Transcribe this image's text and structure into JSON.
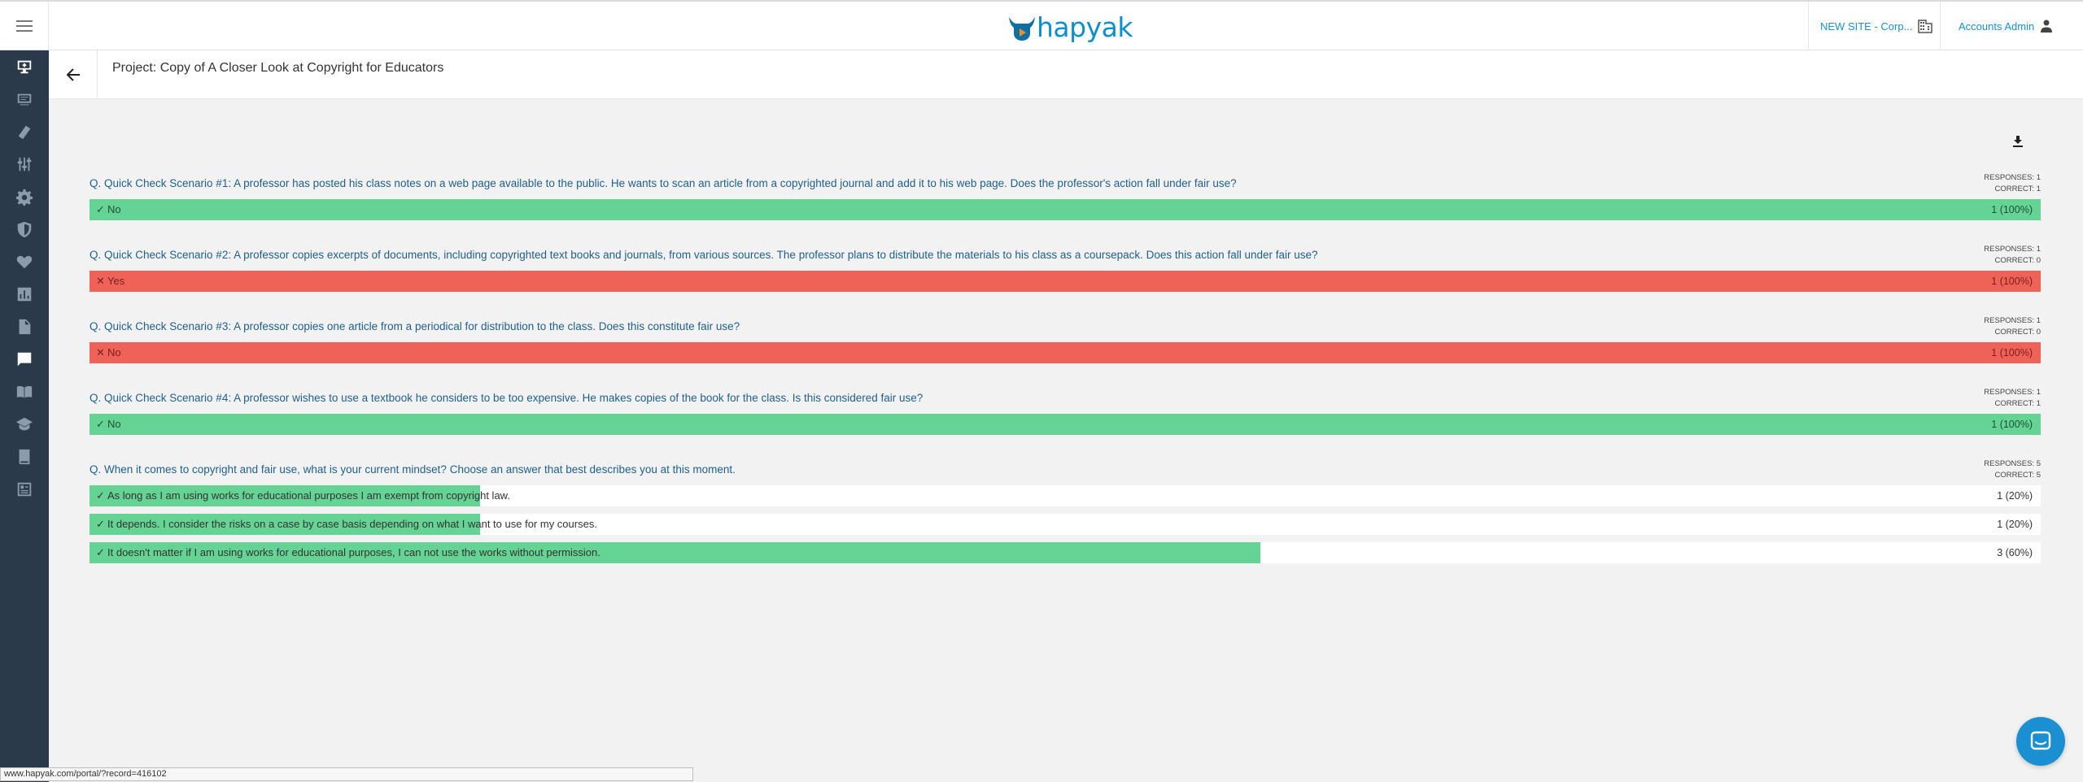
{
  "header": {
    "logo_text": "hapyak",
    "site_selector": "NEW SITE - Corp...",
    "account": "Accounts Admin"
  },
  "sidebar": {
    "items": [
      {
        "icon": "video-add-icon",
        "active": false
      },
      {
        "icon": "playlist-icon",
        "active": false
      },
      {
        "icon": "layers-icon",
        "active": false
      },
      {
        "icon": "sliders-icon",
        "active": false
      },
      {
        "icon": "gear-icon",
        "active": false
      },
      {
        "icon": "shield-icon",
        "active": false
      },
      {
        "icon": "heart-icon",
        "active": false
      },
      {
        "icon": "bar-chart-icon",
        "active": false
      },
      {
        "icon": "document-icon",
        "active": false
      },
      {
        "icon": "chat-bubble-icon",
        "active": true
      },
      {
        "icon": "book-open-icon",
        "active": false
      },
      {
        "icon": "graduation-cap-icon",
        "active": false
      },
      {
        "icon": "book-icon",
        "active": false
      },
      {
        "icon": "report-icon",
        "active": false
      }
    ]
  },
  "project": {
    "title": "Project: Copy of A Closer Look at Copyright for Educators"
  },
  "questions": [
    {
      "title": "Q. Quick Check Scenario #1: A professor has posted his class notes on a web page available to the public. He wants to scan an article from a copyrighted journal and add it to his web page. Does the professor's action fall under fair use?",
      "responses": "RESPONSES: 1",
      "correct": "CORRECT: 1",
      "answers": [
        {
          "mark": "✓",
          "text": "No",
          "count": "1 (100%)",
          "status": "correct",
          "share": 1.0
        }
      ]
    },
    {
      "title": "Q. Quick Check Scenario #2: A professor copies excerpts of documents, including copyrighted text books and journals, from various sources. The professor plans to distribute the materials to his class as a coursepack. Does this action fall under fair use?",
      "responses": "RESPONSES: 1",
      "correct": "CORRECT: 0",
      "answers": [
        {
          "mark": "✕",
          "text": "Yes",
          "count": "1 (100%)",
          "status": "incorrect",
          "share": 1.0
        }
      ]
    },
    {
      "title": "Q. Quick Check Scenario #3: A professor copies one article from a periodical for distribution to the class. Does this constitute fair use?",
      "responses": "RESPONSES: 1",
      "correct": "CORRECT: 0",
      "answers": [
        {
          "mark": "✕",
          "text": "No",
          "count": "1 (100%)",
          "status": "incorrect",
          "share": 1.0
        }
      ]
    },
    {
      "title": "Q. Quick Check Scenario #4: A professor wishes to use a textbook he considers to be too expensive. He makes copies of the book for the class. Is this considered fair use?",
      "responses": "RESPONSES: 1",
      "correct": "CORRECT: 1",
      "answers": [
        {
          "mark": "✓",
          "text": "No",
          "count": "1 (100%)",
          "status": "correct",
          "share": 1.0
        }
      ]
    },
    {
      "title": "Q. When it comes to copyright and fair use, what is your current mindset? Choose an answer that best describes you at this moment.",
      "responses": "RESPONSES: 5",
      "correct": "CORRECT: 5",
      "answers": [
        {
          "mark": "✓",
          "text": "As long as I am using works for educational purposes I am exempt from copyright law.",
          "count": "1 (20%)",
          "status": "partial",
          "share": 0.2
        },
        {
          "mark": "✓",
          "text": "It depends. I consider the risks on a case by case basis depending on what I want to use for my courses.",
          "count": "1 (20%)",
          "status": "partial",
          "share": 0.2
        },
        {
          "mark": "✓",
          "text": "It doesn't matter if I am using works for educational purposes, I can not use the works without permission.",
          "count": "3 (60%)",
          "status": "partial",
          "share": 0.6
        }
      ]
    }
  ],
  "status_url": "www.hapyak.com/portal/?record=416102"
}
